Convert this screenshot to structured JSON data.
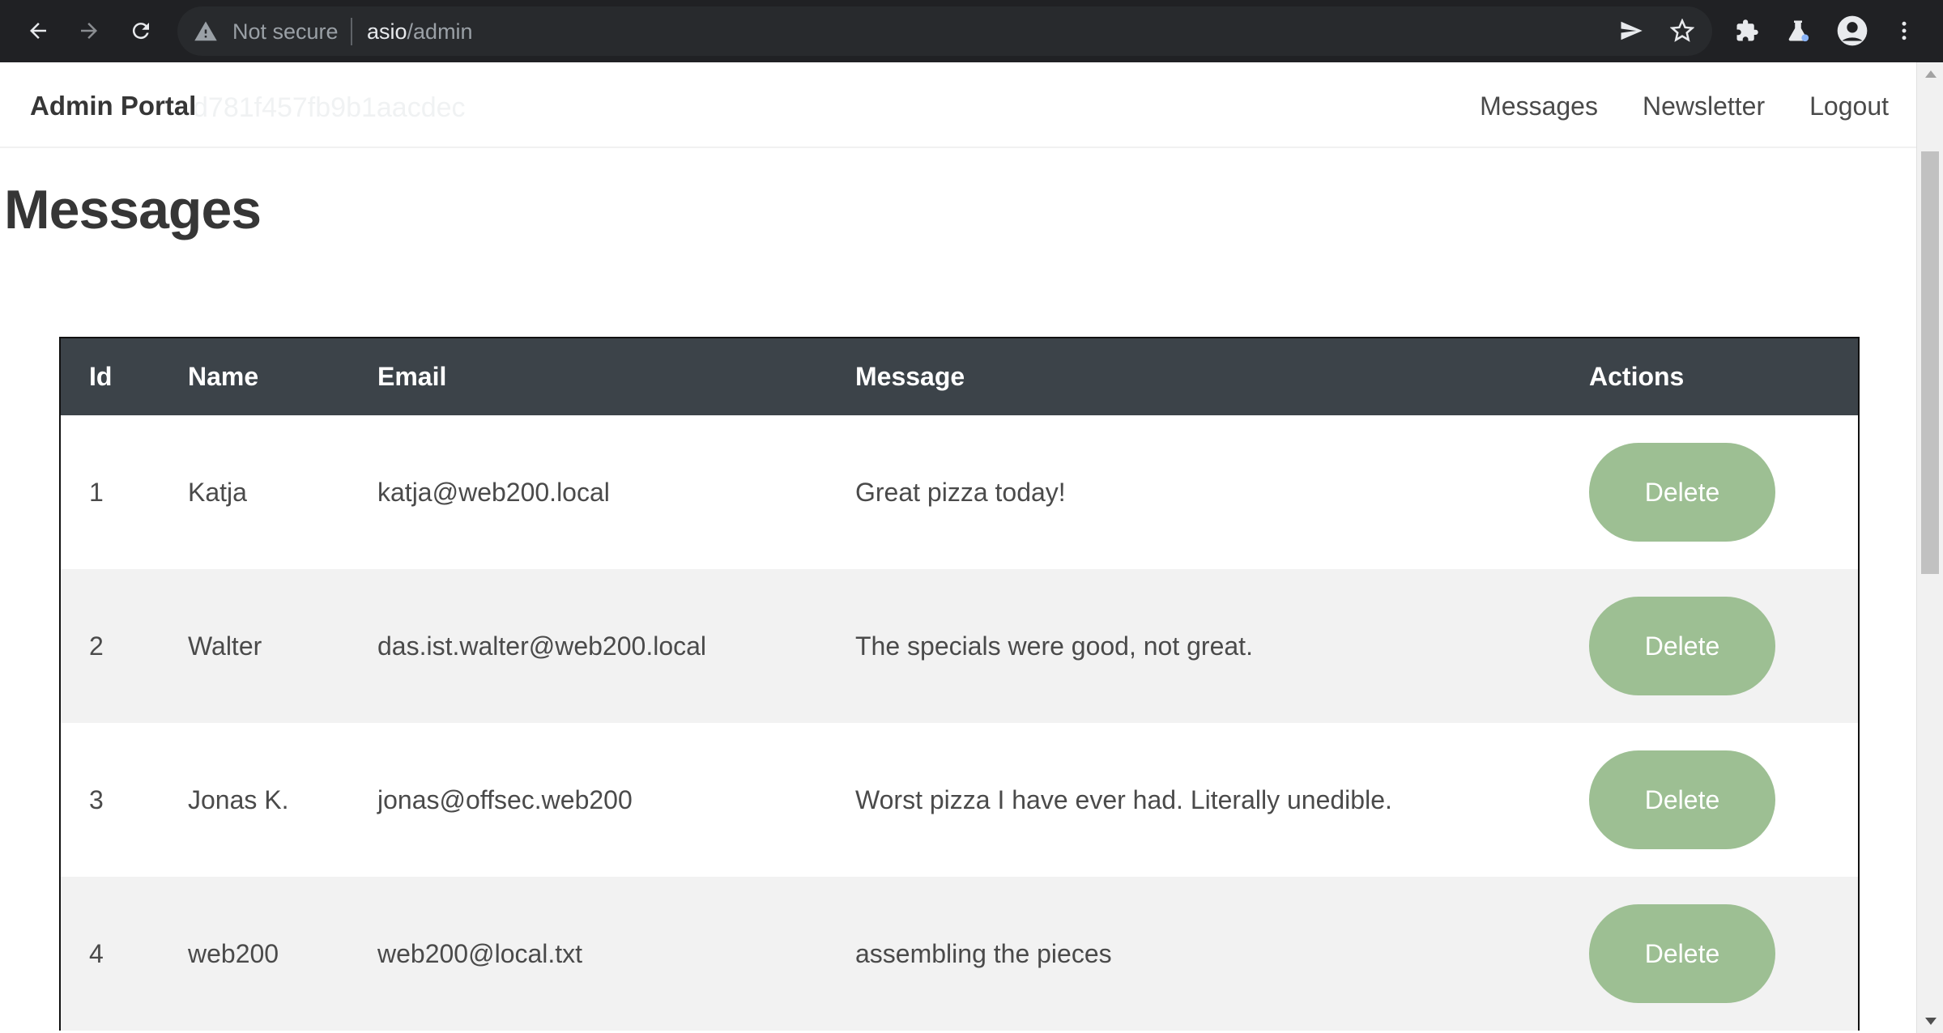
{
  "browser": {
    "security_text": "Not secure",
    "url_host": "asio",
    "url_path": "/admin",
    "icons": [
      "back-icon",
      "forward-icon",
      "reload-icon",
      "warning-icon",
      "send-icon",
      "star-icon",
      "extensions-icon",
      "labs-icon",
      "profile-icon",
      "menu-icon"
    ]
  },
  "navbar": {
    "brand": "Admin Portal",
    "ghost_text": "d781f457fb9b1aacdec",
    "links": [
      "Messages",
      "Newsletter",
      "Logout"
    ]
  },
  "page": {
    "title": "Messages"
  },
  "table": {
    "headers": [
      "Id",
      "Name",
      "Email",
      "Message",
      "Actions"
    ],
    "rows": [
      {
        "id": "1",
        "name": "Katja",
        "email": "katja@web200.local",
        "message": "Great pizza today!",
        "action": "Delete"
      },
      {
        "id": "2",
        "name": "Walter",
        "email": "das.ist.walter@web200.local",
        "message": "The specials were good, not great.",
        "action": "Delete"
      },
      {
        "id": "3",
        "name": "Jonas K.",
        "email": "jonas@offsec.web200",
        "message": "Worst pizza I have ever had. Literally unedible.",
        "action": "Delete"
      },
      {
        "id": "4",
        "name": "web200",
        "email": "web200@local.txt",
        "message": "assembling the pieces",
        "action": "Delete"
      }
    ]
  },
  "colors": {
    "chrome_bg": "#202124",
    "table_header_bg": "#3c4349",
    "delete_button_bg": "#9dbf93",
    "striped_row_bg": "#f2f2f2"
  }
}
